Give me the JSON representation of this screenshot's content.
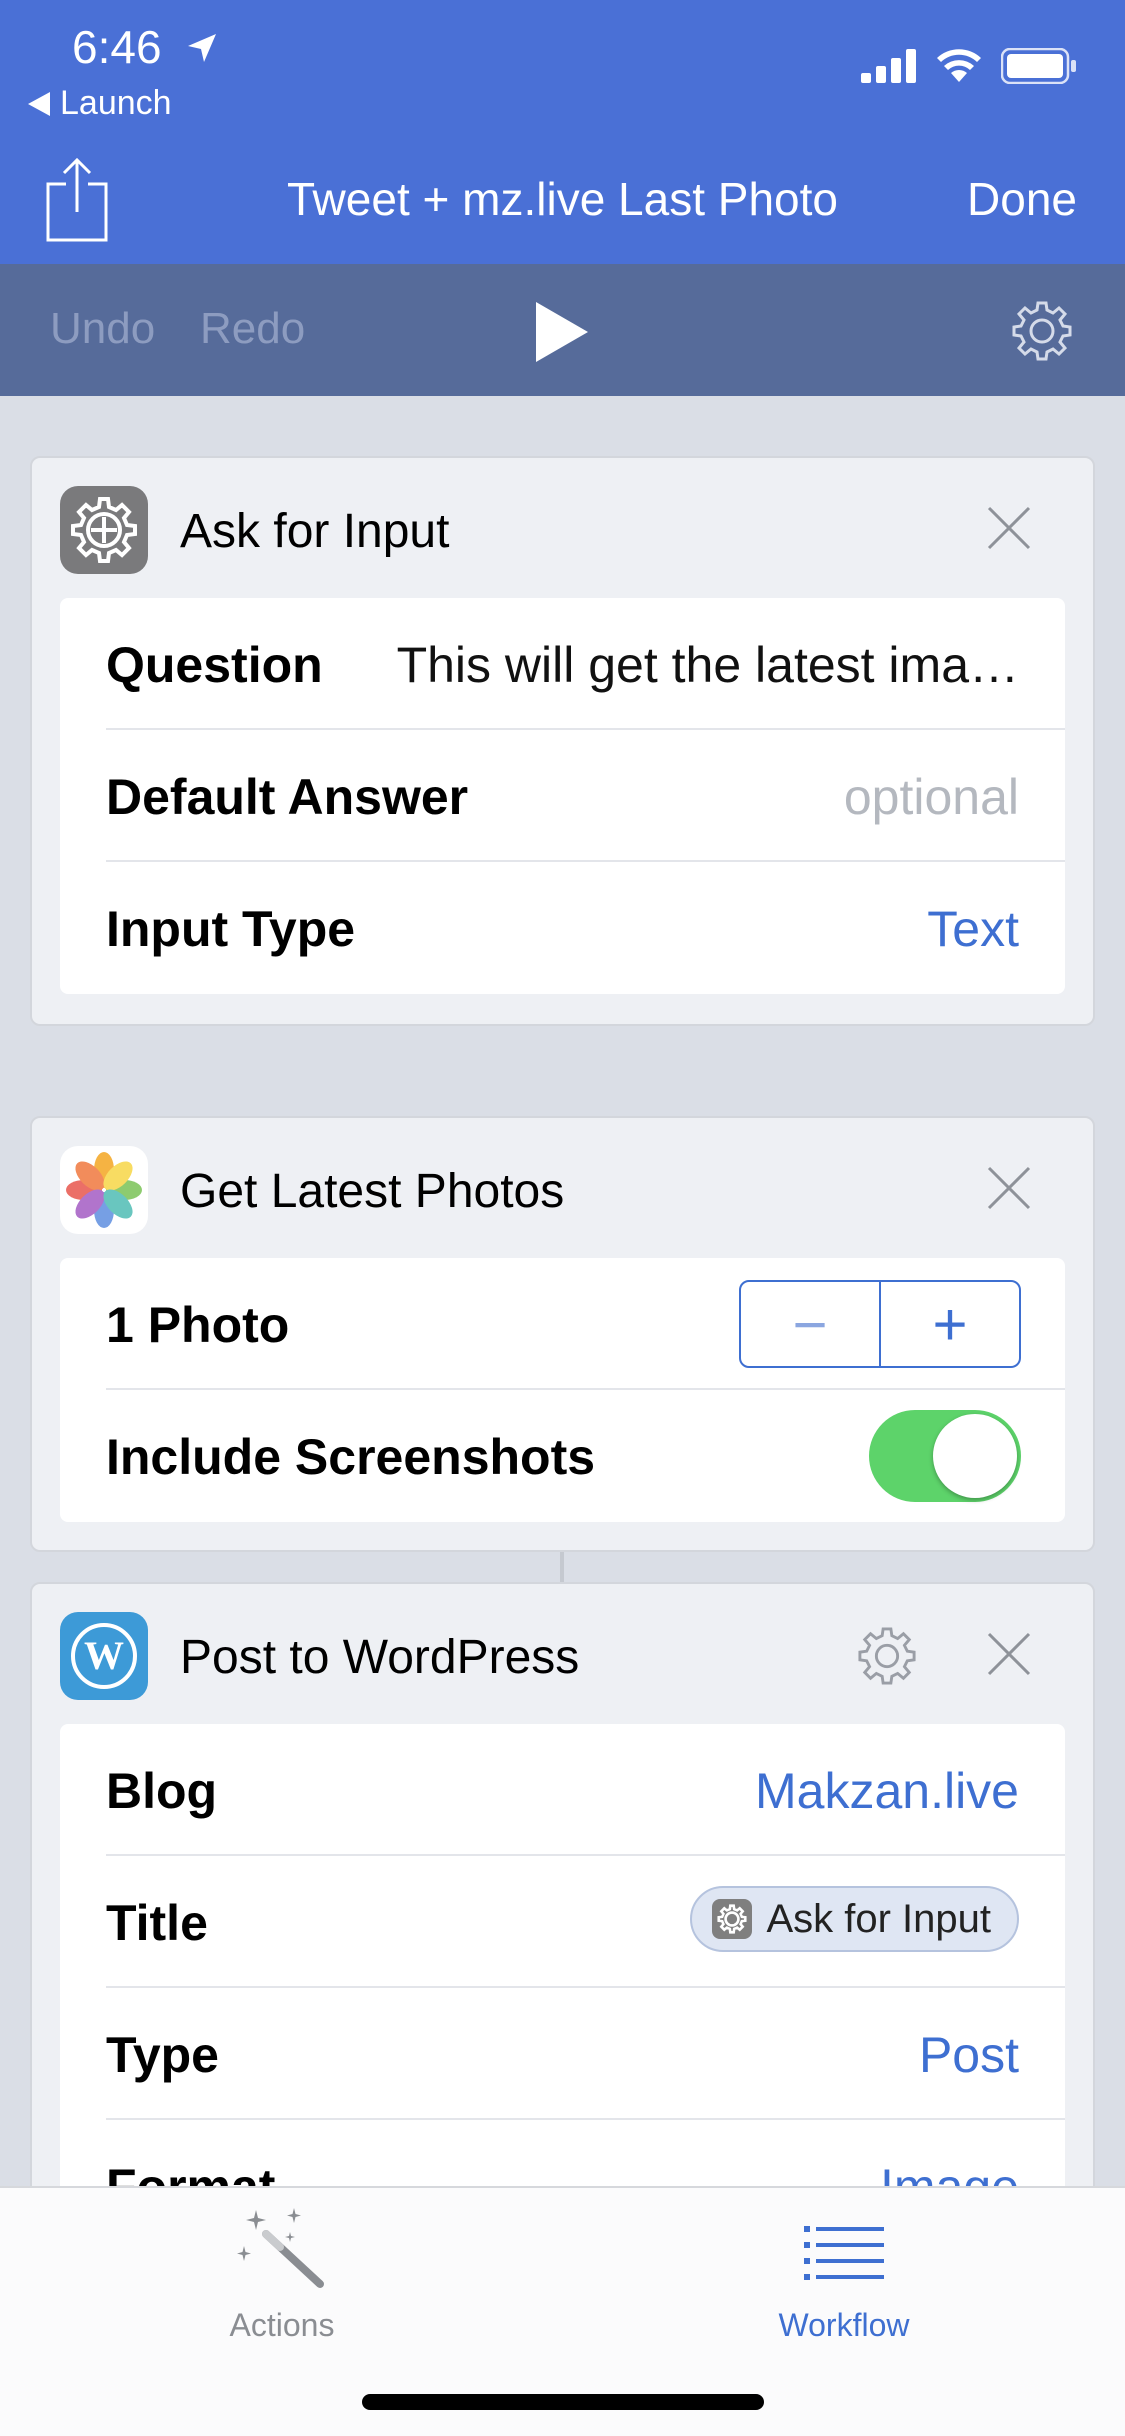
{
  "status_bar": {
    "time": "6:46",
    "back_label": "Launch"
  },
  "nav": {
    "title": "Tweet + mz.live Last Photo",
    "done_label": "Done"
  },
  "toolbar": {
    "undo_label": "Undo",
    "redo_label": "Redo"
  },
  "cards": {
    "ask_for_input": {
      "title": "Ask for Input",
      "rows": [
        {
          "label": "Question",
          "value": "This will get the latest ima…"
        },
        {
          "label": "Default Answer",
          "placeholder": "optional"
        },
        {
          "label": "Input Type",
          "value": "Text"
        }
      ]
    },
    "get_latest_photos": {
      "title": "Get Latest Photos",
      "rows": [
        {
          "label": "1 Photo",
          "stepper_minus": "−",
          "stepper_plus": "+"
        },
        {
          "label": "Include Screenshots",
          "toggle_on": true
        }
      ]
    },
    "post_to_wordpress": {
      "title": "Post to WordPress",
      "rows": [
        {
          "label": "Blog",
          "value": "Makzan.live"
        },
        {
          "label": "Title",
          "pill": "Ask for Input"
        },
        {
          "label": "Type",
          "value": "Post"
        },
        {
          "label": "Format",
          "value": "Image"
        }
      ]
    }
  },
  "tabbar": {
    "actions_label": "Actions",
    "workflow_label": "Workflow"
  },
  "colors": {
    "nav_bg": "#4a70d6",
    "toolbar_bg": "#566b9a",
    "accent_blue": "#3e6fd1",
    "toggle_green": "#5dd36a"
  },
  "icons": [
    "location-arrow-icon",
    "signal-icon",
    "wifi-icon",
    "battery-icon",
    "share-icon",
    "play-icon",
    "gear-icon",
    "close-icon",
    "photos-icon",
    "wordpress-icon",
    "magic-wand-icon",
    "list-icon"
  ]
}
